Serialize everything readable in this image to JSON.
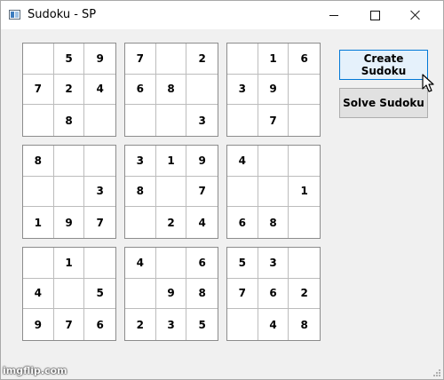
{
  "window": {
    "title": "Sudoku - SP"
  },
  "board": {
    "boxes": [
      [
        [
          "",
          "5",
          "9"
        ],
        [
          "7",
          "2",
          "4"
        ],
        [
          "",
          "8",
          ""
        ]
      ],
      [
        [
          "7",
          "",
          "2"
        ],
        [
          "6",
          "8",
          ""
        ],
        [
          "",
          "",
          "3"
        ]
      ],
      [
        [
          "",
          "1",
          "6"
        ],
        [
          "3",
          "9",
          ""
        ],
        [
          "",
          "7",
          ""
        ]
      ],
      [
        [
          "8",
          "",
          ""
        ],
        [
          "",
          "",
          "3"
        ],
        [
          "1",
          "9",
          "7"
        ]
      ],
      [
        [
          "3",
          "1",
          "9"
        ],
        [
          "8",
          "",
          "7"
        ],
        [
          "",
          "2",
          "4"
        ]
      ],
      [
        [
          "4",
          "",
          ""
        ],
        [
          "",
          "",
          "1"
        ],
        [
          "6",
          "8",
          ""
        ]
      ],
      [
        [
          "",
          "1",
          ""
        ],
        [
          "4",
          "",
          "5"
        ],
        [
          "9",
          "7",
          "6"
        ]
      ],
      [
        [
          "4",
          "",
          "6"
        ],
        [
          "",
          "9",
          "8"
        ],
        [
          "2",
          "3",
          "5"
        ]
      ],
      [
        [
          "5",
          "3",
          ""
        ],
        [
          "7",
          "6",
          "2"
        ],
        [
          "",
          "4",
          "8"
        ]
      ]
    ]
  },
  "buttons": {
    "create_label": "Create Sudoku",
    "solve_label": "Solve Sudoku"
  },
  "watermark": "imgflip.com",
  "colors": {
    "focus_border": "#0078d7",
    "button_face": "#e1e1e1"
  },
  "icons": [
    "app-icon",
    "minimize-icon",
    "maximize-icon",
    "close-icon",
    "mouse-cursor-icon",
    "resize-grip-icon"
  ]
}
